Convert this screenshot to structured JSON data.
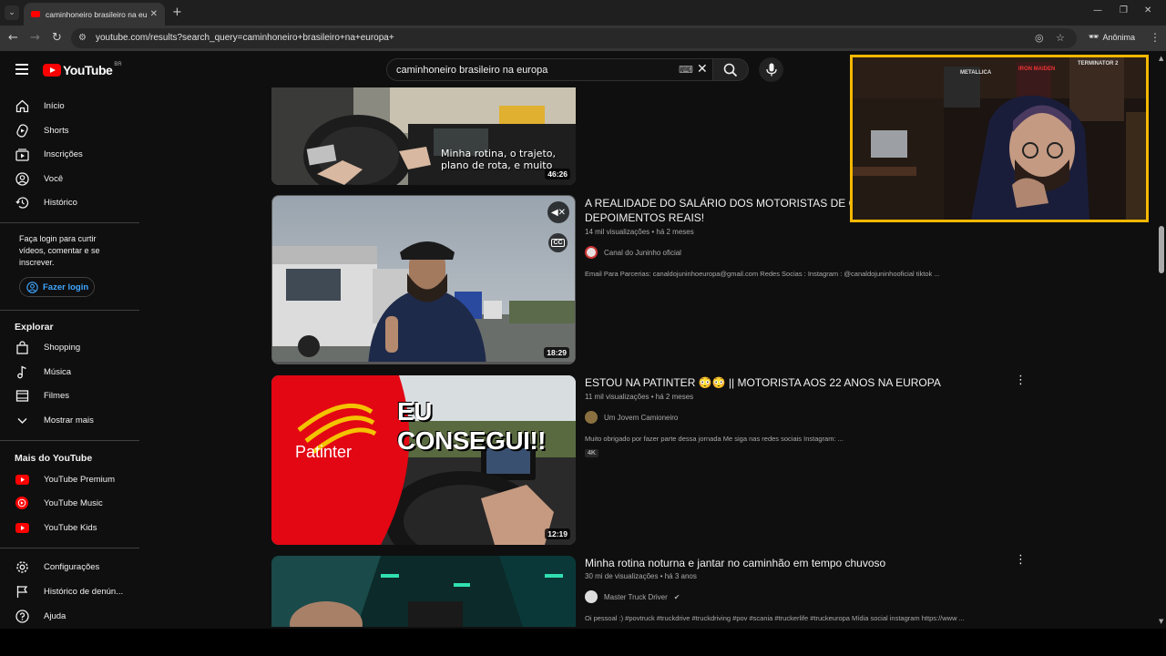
{
  "browser": {
    "tab_title": "caminhoneiro brasileiro na europa - YouTube",
    "url": "youtube.com/results?search_query=caminhoneiro+brasileiro+na+europa+",
    "incognito_label": "Anônima"
  },
  "youtube": {
    "logo_text": "YouTube",
    "country_code": "BR",
    "search_query": "caminhoneiro brasileiro na europa"
  },
  "sidebar": {
    "main_items": [
      {
        "label": "Início",
        "icon": "home-icon"
      },
      {
        "label": "Shorts",
        "icon": "shorts-icon"
      },
      {
        "label": "Inscrições",
        "icon": "subscriptions-icon"
      },
      {
        "label": "Você",
        "icon": "you-icon"
      },
      {
        "label": "Histórico",
        "icon": "history-icon"
      }
    ],
    "login_prompt": "Faça login para curtir vídeos, comentar e se inscrever.",
    "login_button": "Fazer login",
    "explore_heading": "Explorar",
    "explore_items": [
      {
        "label": "Shopping",
        "icon": "shopping-icon"
      },
      {
        "label": "Música",
        "icon": "music-icon"
      },
      {
        "label": "Filmes",
        "icon": "movies-icon"
      },
      {
        "label": "Mostrar mais",
        "icon": "chevron-down-icon"
      }
    ],
    "more_heading": "Mais do YouTube",
    "more_items": [
      {
        "label": "YouTube Premium",
        "icon": "youtube-premium-icon"
      },
      {
        "label": "YouTube Music",
        "icon": "youtube-music-icon"
      },
      {
        "label": "YouTube Kids",
        "icon": "youtube-kids-icon"
      }
    ],
    "bottom_items": [
      {
        "label": "Configurações",
        "icon": "settings-icon"
      },
      {
        "label": "Histórico de denún...",
        "icon": "flag-icon"
      },
      {
        "label": "Ajuda",
        "icon": "help-icon"
      }
    ]
  },
  "results": [
    {
      "duration": "46:26",
      "thumb_caption_1": "Minha rotina, o trajeto,",
      "thumb_caption_2": "plano de rota, e muito"
    },
    {
      "title": "A REALIDADE DO SALÁRIO DOS MOTORISTAS DE CAMINHÃO NA EUROPA! DEPOIMENTOS REAIS!",
      "views": "14 mil visualizações",
      "age": "há 2 meses",
      "channel": "Canal do Juninho oficial",
      "description": "Email Para Parcerias: canaldojuninhoeuropa@gmail.com Redes Socias : Instagram : @canaldojuninhooficial tiktok ...",
      "duration": "18:29",
      "cc_label": "CC"
    },
    {
      "title": "ESTOU NA PATINTER 😳😳 || MOTORISTA AOS 22 ANOS NA EUROPA",
      "views": "11 mil visualizações",
      "age": "há 2 meses",
      "channel": "Um Jovem Camioneiro",
      "description": "Muito obrigado por fazer parte dessa jornada Me siga nas redes sociais Instagram: ...",
      "badge": "4K",
      "duration": "12:19",
      "thumb_headline": "EU CONSEGUI!!",
      "thumb_brand": "Patinter"
    },
    {
      "title": "Minha rotina noturna e jantar no caminhão em tempo chuvoso",
      "views": "30 mi de visualizações",
      "age": "há 3 anos",
      "channel": "Master Truck Driver",
      "description": "Oi pessoal :) #povtruck #truckdrive #truckdriving #pov #scania #truckerlife #truckeuropa Mídia social instagram https://www ..."
    }
  ],
  "webcam": {
    "poster_1": "METALLICA",
    "poster_2": "IRON MAIDEN",
    "poster_3": "TERMINATOR 2",
    "accent_color": "#f5b800"
  }
}
